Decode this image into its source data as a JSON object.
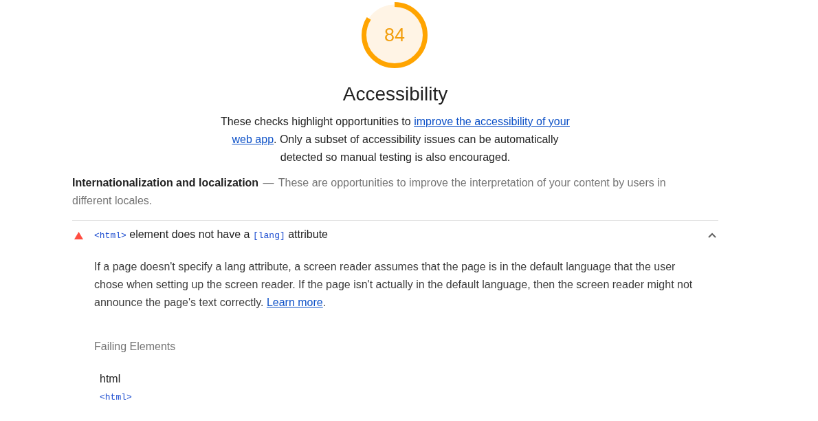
{
  "gauge": {
    "score": "84",
    "level": 0.84
  },
  "category": {
    "title": "Accessibility",
    "description": [
      {
        "kind": "text",
        "text": "These checks highlight opportunities to "
      },
      {
        "kind": "link",
        "text": "improve the accessibility of your"
      },
      {
        "kind": "link",
        "text": "web app"
      },
      {
        "kind": "text",
        "text": ". Only a subset of accessibility issues can be automatically detected so manual testing is also encouraged."
      }
    ]
  },
  "group": {
    "title": "Internationalization and localization",
    "separator": "—",
    "description": "These are opportunities to improve the interpretation of your content by users in different locales."
  },
  "audits": [
    {
      "expanded": true,
      "title": [
        {
          "kind": "code",
          "text": "<html>"
        },
        {
          "kind": "text",
          "text": " element does not have a "
        },
        {
          "kind": "code",
          "text": "[lang]"
        },
        {
          "kind": "text",
          "text": " attribute"
        }
      ],
      "description": [
        {
          "kind": "text",
          "text": "If a page doesn't specify a lang attribute, a screen reader assumes that the page is in the default language that the user chose when setting up the screen reader. If the page isn't actually in the default language, then the screen reader might not announce the page's text correctly. "
        },
        {
          "kind": "link",
          "text": "Learn more"
        },
        {
          "kind": "text",
          "text": "."
        }
      ],
      "failing": {
        "heading": "Failing Elements",
        "items": [
          {
            "label": "html",
            "snippet": "<html>"
          }
        ]
      }
    }
  ]
}
